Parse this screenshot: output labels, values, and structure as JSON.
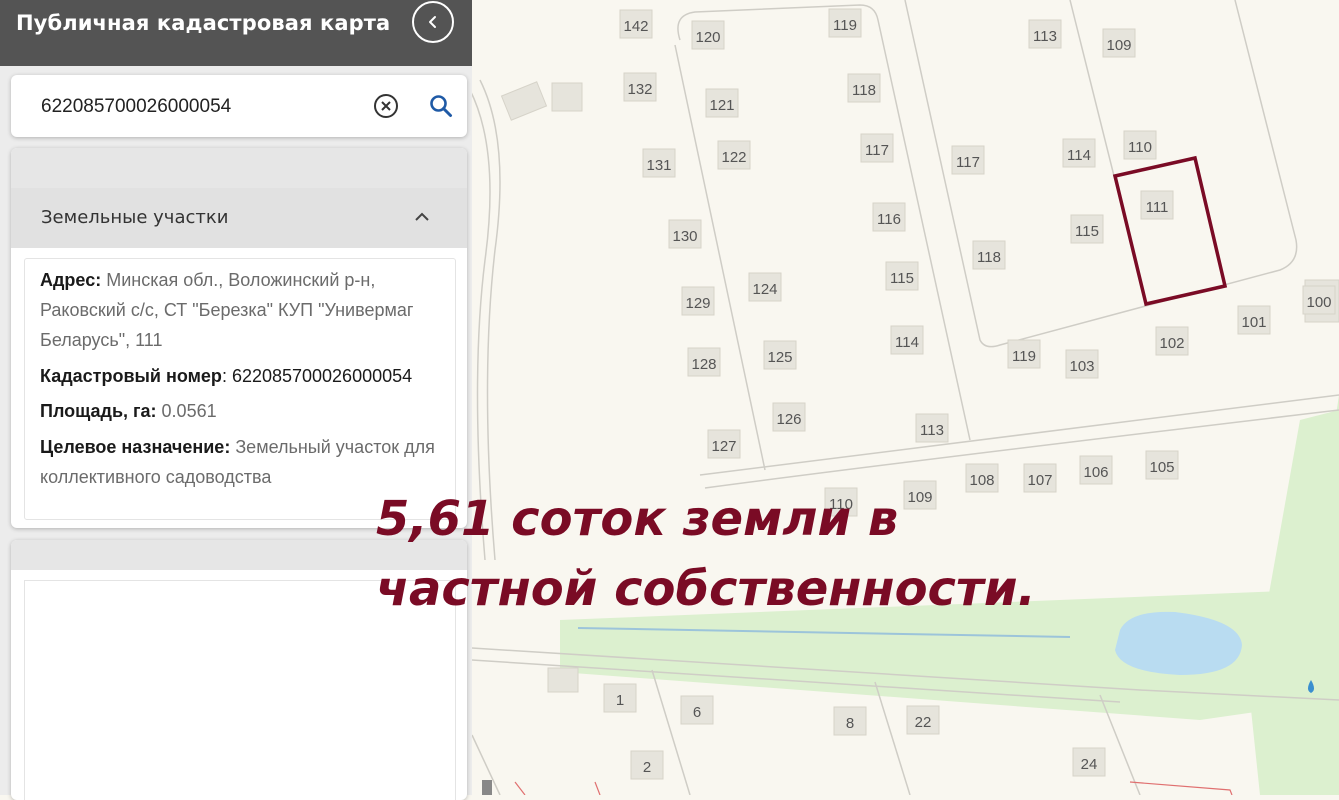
{
  "header": {
    "title": "Публичная кадастровая карта"
  },
  "search": {
    "value": "622085700026000054"
  },
  "section": {
    "label": "Земельные участки"
  },
  "parcel": {
    "address_label": "Адрес:",
    "address_value": " Минская обл., Воложинский р-н, Раковский с/с, СТ \"Березка\" КУП \"Универмаг Беларусь\", 111",
    "cadastral_label": "Кадастровый номер",
    "cadastral_value": ": 622085700026000054",
    "area_label": "Площадь, га:",
    "area_value": " 0.0561",
    "purpose_label": "Целевое назначение:",
    "purpose_value": " Земельный участок для коллективного садоводства"
  },
  "overlay": {
    "line1": "5,61 соток земли в",
    "line2": "частной собственности."
  },
  "colors": {
    "accent": "#7a0b25",
    "header": "#545454",
    "water": "#b9dcf1",
    "grass": "#dcf0cf",
    "building": "#e6e4dc"
  },
  "map": {
    "plots": [
      "142",
      "120",
      "119",
      "113",
      "109",
      "132",
      "121",
      "118",
      "131",
      "122",
      "117",
      "117",
      "114",
      "110",
      "111",
      "130",
      "116",
      "115",
      "118",
      "129",
      "124",
      "115",
      "100",
      "128",
      "125",
      "114",
      "119",
      "103",
      "102",
      "101",
      "126",
      "113",
      "127",
      "108",
      "107",
      "106",
      "105",
      "109",
      "110",
      "1",
      "6",
      "8",
      "22",
      "2",
      "24"
    ]
  }
}
